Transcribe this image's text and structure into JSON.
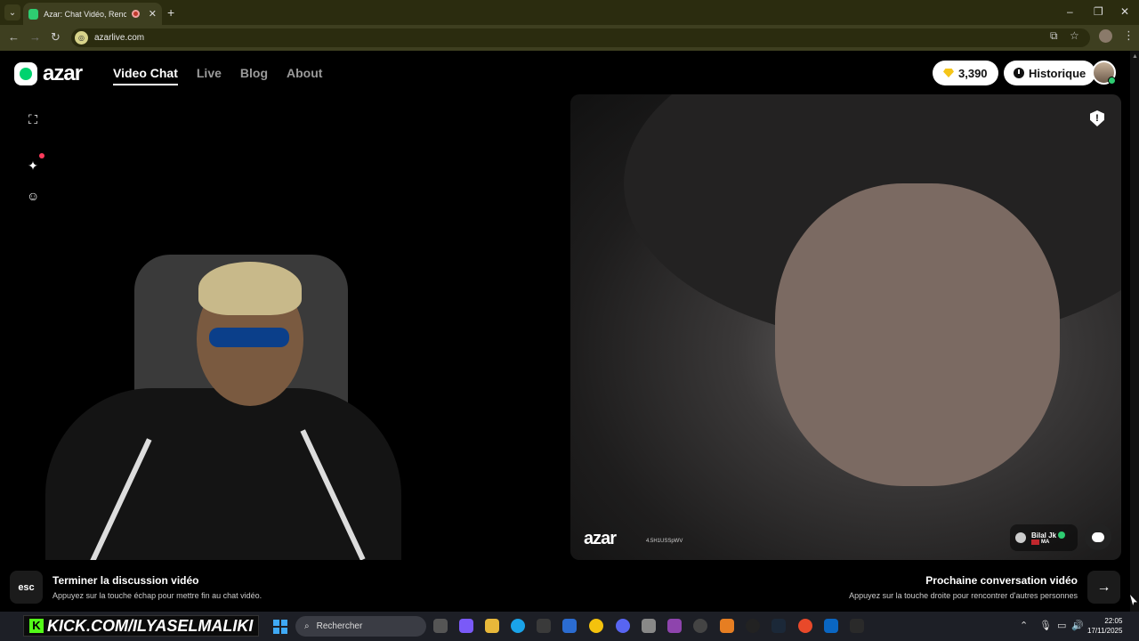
{
  "browser": {
    "tab_title": "Azar: Chat Vidéo, Rencontr",
    "url": "azarlive.com",
    "new_tab_icon": "plus-icon"
  },
  "header": {
    "logo_text": "azar",
    "nav": [
      {
        "label": "Video Chat",
        "active": true
      },
      {
        "label": "Live",
        "active": false
      },
      {
        "label": "Blog",
        "active": false
      },
      {
        "label": "About",
        "active": false
      }
    ],
    "gems": "3,390",
    "history_label": "Historique"
  },
  "left_panel": {
    "icons": [
      "fullscreen-icon",
      "sparkle-effects-icon",
      "face-filter-icon"
    ]
  },
  "right_panel": {
    "watermark_logo": "azar",
    "watermark_id": "4.5H1USSpWV",
    "partner_name": "Bilal Jk",
    "partner_country": "MA"
  },
  "bottom": {
    "end_key": "esc",
    "end_title": "Terminer la discussion vidéo",
    "end_subtitle": "Appuyez sur la touche échap pour mettre fin au chat vidéo.",
    "next_title": "Prochaine conversation vidéo",
    "next_subtitle": "Appuyez sur la touche droite pour rencontrer d'autres personnes"
  },
  "taskbar": {
    "overlay_text": "KICK.COM/ILYASELMALIKI",
    "search_placeholder": "Rechercher",
    "time": "22:05",
    "date": "17/11/2025"
  },
  "colors": {
    "brand_green": "#00d36f",
    "notification_red": "#ff3b5c",
    "gem_yellow": "#f5c518"
  }
}
